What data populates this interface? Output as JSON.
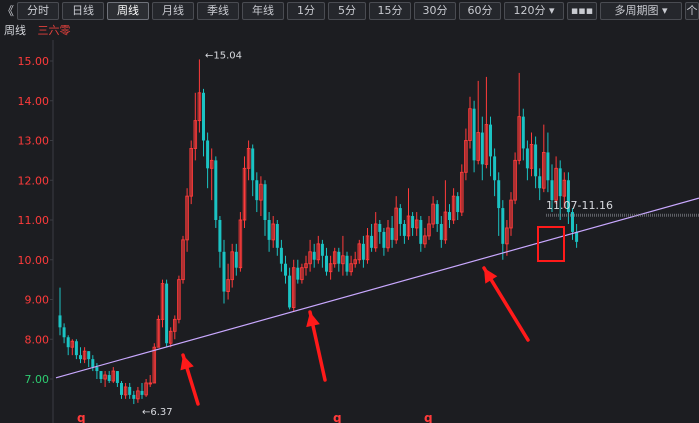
{
  "toolbar": {
    "back_glyph": "《",
    "tabs": [
      "分时",
      "日线",
      "周线",
      "月线",
      "季线",
      "年线",
      "1分",
      "5分",
      "15分",
      "30分",
      "60分",
      "120分 ▾",
      "▪▪▪",
      "多周期图 ▾",
      "个"
    ],
    "active_tab": "周线"
  },
  "info": {
    "period": "周线",
    "stock_name": "三六零"
  },
  "chart_data": {
    "type": "candlestick",
    "ylim": [
      6.0,
      15.5
    ],
    "y_ticks": [
      "15.00",
      "14.00",
      "13.00",
      "12.00",
      "11.00",
      "10.00",
      "9.00",
      "8.00",
      "7.00"
    ],
    "y_tick_values": [
      15,
      14,
      13,
      12,
      11,
      10,
      9,
      8,
      7
    ],
    "annotations": {
      "high": "←15.04",
      "low": "←6.37",
      "range": "11.07-11.16"
    },
    "trendline": {
      "from": [
        0,
        7.03
      ],
      "to": [
        157,
        11.55
      ]
    },
    "markers": [
      "q",
      "q",
      "q"
    ],
    "colors": {
      "up": "#ff3b3b",
      "down": "#1bc3c3",
      "trendline": "#c9a8ff",
      "arrow": "#ff1a1a",
      "axis_up": "#ff3b3b",
      "axis_down": "#2ecc71"
    },
    "candles": [
      [
        8.6,
        8.3,
        9.3,
        8.1
      ],
      [
        8.3,
        8.05,
        8.4,
        7.9
      ],
      [
        8.05,
        7.8,
        8.1,
        7.6
      ],
      [
        7.8,
        7.95,
        8.0,
        7.6
      ],
      [
        7.95,
        7.6,
        8.0,
        7.5
      ],
      [
        7.6,
        7.5,
        7.8,
        7.4
      ],
      [
        7.5,
        7.7,
        7.8,
        7.4
      ],
      [
        7.7,
        7.5,
        7.7,
        7.3
      ],
      [
        7.5,
        7.3,
        7.6,
        7.2
      ],
      [
        7.3,
        7.2,
        7.4,
        7.0
      ],
      [
        7.2,
        7.0,
        7.2,
        6.9
      ],
      [
        7.0,
        7.1,
        7.2,
        6.8
      ],
      [
        7.1,
        6.95,
        7.2,
        6.9
      ],
      [
        6.95,
        7.2,
        7.3,
        6.9
      ],
      [
        7.2,
        6.9,
        7.2,
        6.8
      ],
      [
        6.9,
        6.6,
        6.95,
        6.5
      ],
      [
        6.6,
        6.8,
        6.9,
        6.5
      ],
      [
        6.8,
        6.6,
        6.9,
        6.5
      ],
      [
        6.6,
        6.5,
        6.7,
        6.37
      ],
      [
        6.5,
        6.7,
        6.8,
        6.4
      ],
      [
        6.7,
        6.6,
        6.9,
        6.5
      ],
      [
        6.6,
        6.9,
        7.0,
        6.55
      ],
      [
        6.9,
        6.9,
        7.1,
        6.8
      ],
      [
        6.9,
        7.8,
        7.9,
        6.9
      ],
      [
        7.8,
        8.5,
        8.6,
        7.8
      ],
      [
        8.5,
        9.4,
        9.5,
        8.3
      ],
      [
        9.4,
        7.9,
        9.5,
        7.8
      ],
      [
        7.9,
        8.2,
        8.3,
        7.8
      ],
      [
        8.2,
        8.5,
        8.6,
        8.0
      ],
      [
        8.5,
        9.5,
        9.6,
        8.4
      ],
      [
        9.5,
        10.5,
        10.6,
        9.4
      ],
      [
        10.5,
        11.6,
        11.8,
        10.2
      ],
      [
        11.6,
        12.8,
        13.0,
        11.4
      ],
      [
        12.8,
        13.5,
        14.2,
        12.5
      ],
      [
        13.5,
        14.2,
        15.04,
        13.2
      ],
      [
        14.2,
        13.0,
        14.3,
        12.6
      ],
      [
        13.0,
        12.3,
        13.2,
        11.8
      ],
      [
        12.3,
        12.5,
        12.8,
        11.5
      ],
      [
        12.5,
        11.0,
        12.6,
        10.8
      ],
      [
        11.0,
        10.2,
        11.1,
        9.8
      ],
      [
        10.2,
        9.2,
        10.5,
        8.9
      ],
      [
        9.2,
        9.5,
        9.9,
        9.0
      ],
      [
        9.5,
        10.2,
        10.4,
        9.3
      ],
      [
        10.2,
        9.8,
        10.4,
        9.6
      ],
      [
        9.8,
        11.0,
        11.2,
        9.7
      ],
      [
        11.0,
        12.3,
        12.6,
        10.8
      ],
      [
        12.3,
        12.8,
        13.0,
        12.0
      ],
      [
        12.8,
        12.0,
        12.9,
        11.6
      ],
      [
        12.0,
        11.5,
        12.2,
        11.2
      ],
      [
        11.5,
        11.9,
        12.1,
        11.1
      ],
      [
        11.9,
        11.0,
        12.0,
        10.6
      ],
      [
        11.0,
        10.5,
        11.2,
        10.2
      ],
      [
        10.5,
        10.9,
        11.1,
        10.3
      ],
      [
        10.9,
        10.3,
        11.0,
        10.1
      ],
      [
        10.3,
        9.9,
        10.5,
        9.7
      ],
      [
        9.9,
        9.6,
        10.1,
        9.4
      ],
      [
        9.6,
        8.8,
        9.8,
        8.75
      ],
      [
        8.8,
        9.8,
        10.0,
        8.7
      ],
      [
        9.8,
        9.5,
        10.0,
        9.4
      ],
      [
        9.5,
        9.8,
        9.9,
        9.4
      ],
      [
        9.8,
        9.9,
        10.1,
        9.6
      ],
      [
        9.9,
        10.2,
        10.5,
        9.7
      ],
      [
        10.2,
        10.0,
        10.4,
        9.8
      ],
      [
        10.0,
        10.4,
        10.6,
        9.9
      ],
      [
        10.4,
        10.1,
        10.5,
        9.8
      ],
      [
        10.1,
        9.7,
        10.3,
        9.6
      ],
      [
        9.7,
        9.9,
        10.1,
        9.5
      ],
      [
        9.9,
        10.2,
        10.3,
        9.8
      ],
      [
        10.2,
        9.9,
        10.3,
        9.7
      ],
      [
        9.9,
        10.1,
        10.6,
        9.6
      ],
      [
        10.1,
        9.7,
        10.2,
        9.6
      ],
      [
        9.7,
        9.9,
        10.1,
        9.6
      ],
      [
        9.9,
        10.0,
        10.2,
        9.8
      ],
      [
        10.0,
        10.4,
        10.5,
        9.9
      ],
      [
        10.4,
        10.0,
        10.6,
        9.8
      ],
      [
        10.0,
        10.6,
        10.8,
        9.9
      ],
      [
        10.6,
        10.3,
        10.9,
        10.2
      ],
      [
        10.3,
        10.9,
        11.2,
        10.2
      ],
      [
        10.9,
        10.7,
        11.0,
        10.4
      ],
      [
        10.7,
        10.3,
        10.8,
        10.1
      ],
      [
        10.3,
        10.8,
        11.0,
        10.2
      ],
      [
        10.8,
        10.5,
        11.1,
        10.3
      ],
      [
        10.5,
        11.3,
        11.6,
        10.4
      ],
      [
        11.3,
        10.9,
        11.4,
        10.6
      ],
      [
        10.9,
        10.6,
        11.0,
        10.4
      ],
      [
        10.6,
        11.1,
        11.8,
        10.5
      ],
      [
        11.1,
        10.8,
        11.2,
        10.6
      ],
      [
        10.8,
        11.0,
        11.2,
        10.6
      ],
      [
        11.0,
        10.4,
        11.1,
        10.2
      ],
      [
        10.4,
        10.6,
        10.8,
        10.3
      ],
      [
        10.6,
        10.9,
        11.1,
        10.5
      ],
      [
        10.9,
        11.4,
        11.6,
        10.8
      ],
      [
        11.4,
        10.9,
        11.5,
        10.7
      ],
      [
        10.9,
        10.5,
        11.1,
        10.3
      ],
      [
        10.5,
        11.2,
        12.0,
        10.4
      ],
      [
        11.2,
        11.0,
        11.4,
        10.8
      ],
      [
        11.0,
        11.6,
        11.8,
        10.9
      ],
      [
        11.6,
        11.2,
        11.7,
        11.0
      ],
      [
        11.2,
        12.2,
        12.4,
        11.1
      ],
      [
        12.2,
        13.0,
        13.3,
        12.0
      ],
      [
        13.0,
        13.8,
        14.1,
        12.8
      ],
      [
        13.8,
        12.5,
        14.0,
        12.2
      ],
      [
        12.5,
        13.2,
        14.5,
        12.4
      ],
      [
        13.2,
        12.4,
        13.6,
        12.0
      ],
      [
        12.4,
        13.4,
        14.6,
        12.3
      ],
      [
        13.4,
        12.6,
        13.6,
        12.1
      ],
      [
        12.6,
        12.0,
        12.8,
        11.6
      ],
      [
        12.0,
        11.3,
        12.2,
        10.6
      ],
      [
        11.3,
        10.4,
        11.5,
        10.0
      ],
      [
        10.4,
        10.8,
        11.0,
        10.1
      ],
      [
        10.8,
        11.5,
        11.7,
        10.6
      ],
      [
        11.5,
        12.5,
        12.7,
        11.4
      ],
      [
        12.5,
        13.6,
        14.7,
        12.4
      ],
      [
        13.6,
        12.8,
        13.8,
        12.5
      ],
      [
        12.8,
        12.3,
        13.0,
        12.0
      ],
      [
        12.3,
        12.9,
        13.2,
        12.1
      ],
      [
        12.9,
        12.1,
        13.1,
        11.8
      ],
      [
        12.1,
        11.8,
        12.3,
        11.5
      ],
      [
        11.8,
        12.7,
        13.4,
        11.7
      ],
      [
        12.7,
        12.0,
        13.2,
        11.7
      ],
      [
        12.0,
        11.5,
        12.4,
        11.2
      ],
      [
        11.5,
        12.3,
        12.6,
        11.4
      ],
      [
        12.3,
        11.6,
        12.5,
        11.0
      ],
      [
        11.6,
        12.0,
        12.2,
        11.3
      ],
      [
        12.0,
        11.2,
        12.2,
        10.9
      ],
      [
        11.2,
        10.7,
        11.3,
        10.5
      ],
      [
        10.7,
        10.45,
        10.9,
        10.3
      ]
    ]
  }
}
